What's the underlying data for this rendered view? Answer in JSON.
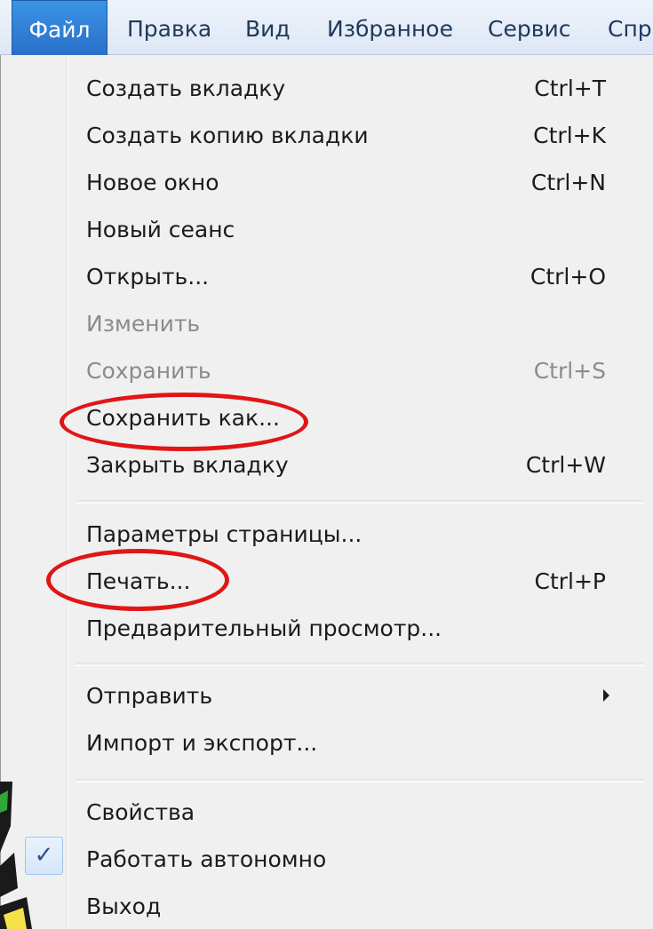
{
  "menubar": {
    "items": [
      {
        "label": "Файл"
      },
      {
        "label": "Правка"
      },
      {
        "label": "Вид"
      },
      {
        "label": "Избранное"
      },
      {
        "label": "Сервис"
      },
      {
        "label": "Спр"
      }
    ]
  },
  "menu": {
    "items": [
      {
        "label": "Создать вкладку",
        "shortcut": "Ctrl+T",
        "enabled": true
      },
      {
        "label": "Создать копию вкладки",
        "shortcut": "Ctrl+K",
        "enabled": true
      },
      {
        "label": "Новое окно",
        "shortcut": "Ctrl+N",
        "enabled": true
      },
      {
        "label": "Новый сеанс",
        "shortcut": "",
        "enabled": true
      },
      {
        "label": "Открыть...",
        "shortcut": "Ctrl+O",
        "enabled": true
      },
      {
        "label": "Изменить",
        "shortcut": "",
        "enabled": false
      },
      {
        "label": "Сохранить",
        "shortcut": "Ctrl+S",
        "enabled": false
      },
      {
        "label": "Сохранить как...",
        "shortcut": "",
        "enabled": true,
        "highlighted": true
      },
      {
        "label": "Закрыть вкладку",
        "shortcut": "Ctrl+W",
        "enabled": true
      },
      {
        "label": "Параметры страницы...",
        "shortcut": "",
        "enabled": true
      },
      {
        "label": "Печать...",
        "shortcut": "Ctrl+P",
        "enabled": true,
        "highlighted": true
      },
      {
        "label": "Предварительный просмотр...",
        "shortcut": "",
        "enabled": true
      },
      {
        "label": "Отправить",
        "shortcut": "",
        "enabled": true,
        "submenu": true
      },
      {
        "label": "Импорт и экспорт...",
        "shortcut": "",
        "enabled": true
      },
      {
        "label": "Свойства",
        "shortcut": "",
        "enabled": true
      },
      {
        "label": "Работать автономно",
        "shortcut": "",
        "enabled": true,
        "checked": true
      },
      {
        "label": "Выход",
        "shortcut": "",
        "enabled": true
      }
    ],
    "check_glyph": "✓"
  },
  "colors": {
    "highlight_circle": "#e01616",
    "active_menubar": "#2a6fc9",
    "disabled_text": "#8b8b8b"
  }
}
